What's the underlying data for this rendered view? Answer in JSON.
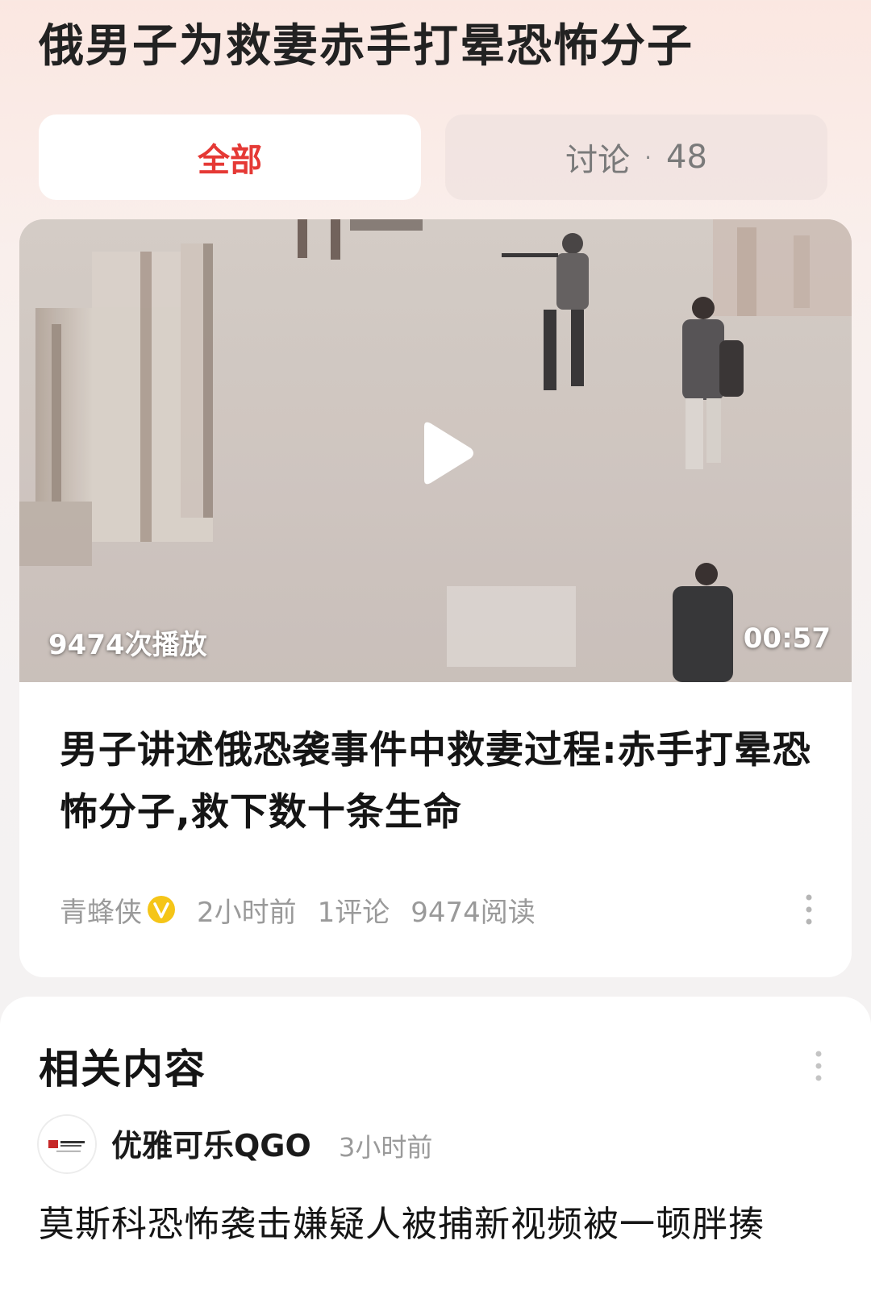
{
  "page": {
    "title": "俄男子为救妻赤手打晕恐怖分子"
  },
  "tabs": {
    "all_label": "全部",
    "discuss_label": "讨论",
    "discuss_separator": "·",
    "discuss_count": "48",
    "active": "全部",
    "active_color": "#e53935"
  },
  "article": {
    "video": {
      "play_count": "9474次播放",
      "duration": "00:57",
      "icon": "play-icon"
    },
    "title": "男子讲述俄恐袭事件中救妻过程:赤手打晕恐怖分子,救下数十条生命",
    "meta": {
      "author": "青蜂侠",
      "verified_icon": "verified-v-badge-icon",
      "verified_color": "#f5c518",
      "time": "2小时前",
      "comments": "1评论",
      "reads": "9474阅读"
    }
  },
  "related": {
    "title": "相关内容",
    "items": [
      {
        "source": "优雅可乐QGO",
        "time": "3小时前",
        "headline": "莫斯科恐怖袭击嫌疑人被捕新视频被一顿胖揍"
      }
    ]
  }
}
